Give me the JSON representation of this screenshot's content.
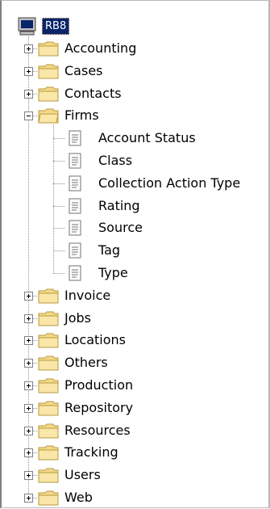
{
  "tree": {
    "root": {
      "label": "RB8",
      "icon": "computer-icon",
      "selected": true
    },
    "nodes": [
      {
        "label": "Accounting",
        "expanded": false
      },
      {
        "label": "Cases",
        "expanded": false
      },
      {
        "label": "Contacts",
        "expanded": false
      },
      {
        "label": "Firms",
        "expanded": true,
        "children": [
          "Account Status",
          "Class",
          "Collection Action Type",
          "Rating",
          "Source",
          "Tag",
          "Type"
        ]
      },
      {
        "label": "Invoice",
        "expanded": false
      },
      {
        "label": "Jobs",
        "expanded": false
      },
      {
        "label": "Locations",
        "expanded": false
      },
      {
        "label": "Others",
        "expanded": false
      },
      {
        "label": "Production",
        "expanded": false
      },
      {
        "label": "Repository",
        "expanded": false
      },
      {
        "label": "Resources",
        "expanded": false
      },
      {
        "label": "Tracking",
        "expanded": false
      },
      {
        "label": "Users",
        "expanded": false
      },
      {
        "label": "Web",
        "expanded": false
      }
    ]
  },
  "colors": {
    "selection": "#0a246a",
    "folder": "#f5d98a",
    "folder_edge": "#b89a3f",
    "connector": "#909090"
  }
}
